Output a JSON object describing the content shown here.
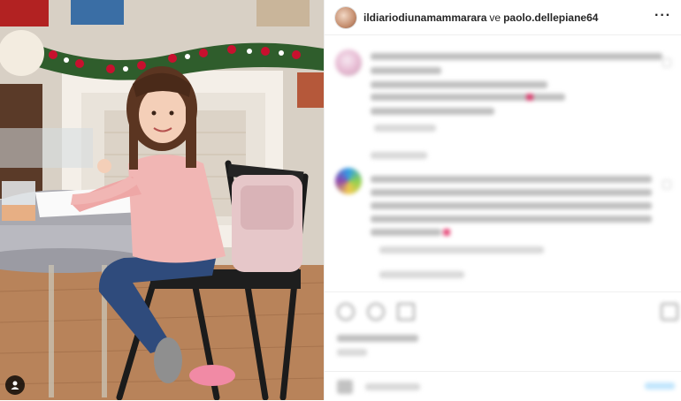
{
  "post": {
    "author": "ildiariodiunamammarara",
    "connector": "ve",
    "collaborator": "paolo.dellepiane64",
    "more_icon": "more-horizontal-icon"
  },
  "comments": [
    {
      "id": "comment-1",
      "blurred": true
    },
    {
      "id": "comment-2",
      "blurred": true
    }
  ],
  "actions": {
    "icons": [
      "heart-icon",
      "comment-icon",
      "share-icon",
      "bookmark-icon"
    ]
  },
  "photo": {
    "subject": "girl-at-table-photo",
    "tag_icon": "user-tag-icon"
  },
  "colors": {
    "border": "#efefef",
    "text": "#262626",
    "post_button": "#b2dffc"
  }
}
